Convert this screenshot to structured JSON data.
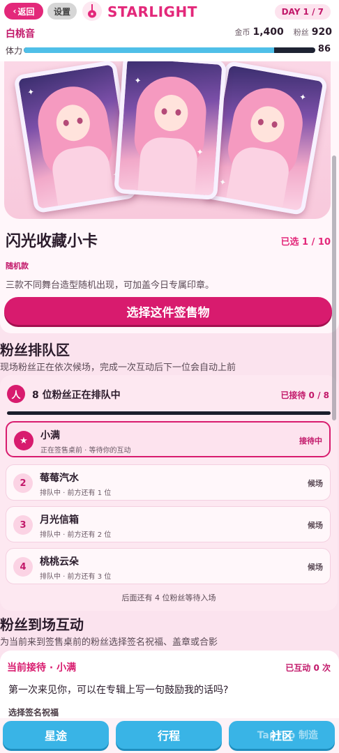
{
  "header": {
    "back_label": "返回",
    "settings_label": "设置",
    "app_title": "STARLIGHT",
    "day_badge": "DAY 1 / 7",
    "player_name": "白桃音",
    "coins_label": "金币",
    "coins_value": "1,400",
    "fans_label": "粉丝",
    "fans_value": "920",
    "stamina_label": "体力",
    "stamina_value": "86",
    "stamina_fraction": 0.86,
    "accent_color": "#e3287a",
    "stamina_color": "#4fbfe8"
  },
  "product": {
    "title": "闪光收藏小卡",
    "selected": "已选 1 / 10",
    "tag": "随机款",
    "desc": "三款不同舞台造型随机出现，可加盖今日专属印章。",
    "select_button": "选择这件签售物"
  },
  "queue": {
    "title": "粉丝排队区",
    "desc": "现场粉丝正在依次候场，完成一次互动后下一位会自动上前",
    "head_icon": "人",
    "head_text": "8 位粉丝正在排队中",
    "served": "已接待 0 / 8",
    "items": [
      {
        "num": "★",
        "name": "小满",
        "sub": "正在签售桌前 · 等待你的互动",
        "state": "接待中"
      },
      {
        "num": "2",
        "name": "莓莓汽水",
        "sub": "排队中 · 前方还有 1 位",
        "state": "候场"
      },
      {
        "num": "3",
        "name": "月光信箱",
        "sub": "排队中 · 前方还有 2 位",
        "state": "候场"
      },
      {
        "num": "4",
        "name": "桃桃云朵",
        "sub": "排队中 · 前方还有 3 位",
        "state": "候场"
      }
    ],
    "more": "后面还有 4 位粉丝等待入场"
  },
  "interaction": {
    "title": "粉丝到场互动",
    "desc": "为当前来到签售桌前的粉丝选择签名祝福、盖章或合影",
    "current": "当前接待 · 小满",
    "count": "已互动 0 次",
    "quote": "第一次来见你，可以在专辑上写一句鼓励我的话吗?",
    "sublabel": "选择签名祝福"
  },
  "nav": {
    "tab1": "星途",
    "tab2": "行程",
    "tab3": "社区",
    "watermark": "TapTap 制造",
    "nav_color": "#39b4e6"
  }
}
